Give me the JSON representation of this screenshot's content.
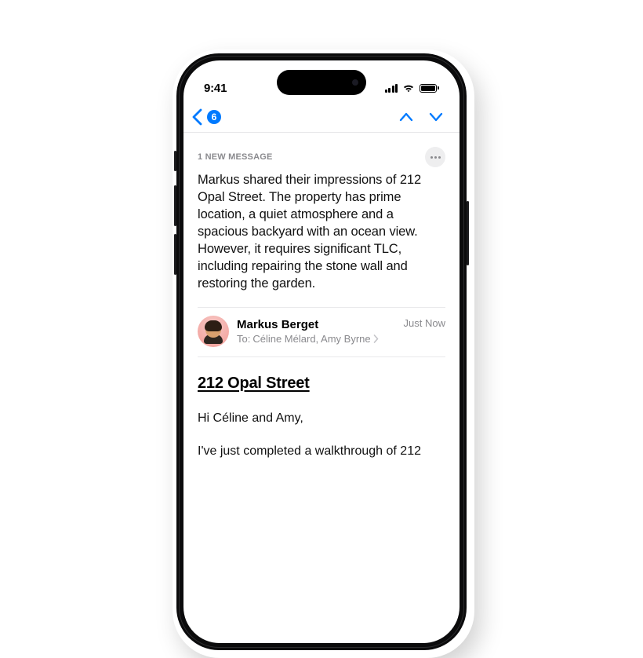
{
  "status": {
    "time": "9:41"
  },
  "nav": {
    "count": "6"
  },
  "summary": {
    "label": "1 NEW MESSAGE",
    "text": "Markus shared their impressions of 212 Opal Street. The property has prime location, a quiet atmosphere and a spacious backyard with an ocean view. However, it requires significant TLC, including repairing the stone wall and restoring the garden."
  },
  "sender": {
    "name": "Markus Berget",
    "to_label": "To:",
    "recipients": "Céline Mélard, Amy Byrne",
    "timestamp": "Just Now"
  },
  "email": {
    "subject": "212 Opal Street",
    "greeting": "Hi Céline and Amy,",
    "line1": "I've just completed a walkthrough of 212"
  }
}
